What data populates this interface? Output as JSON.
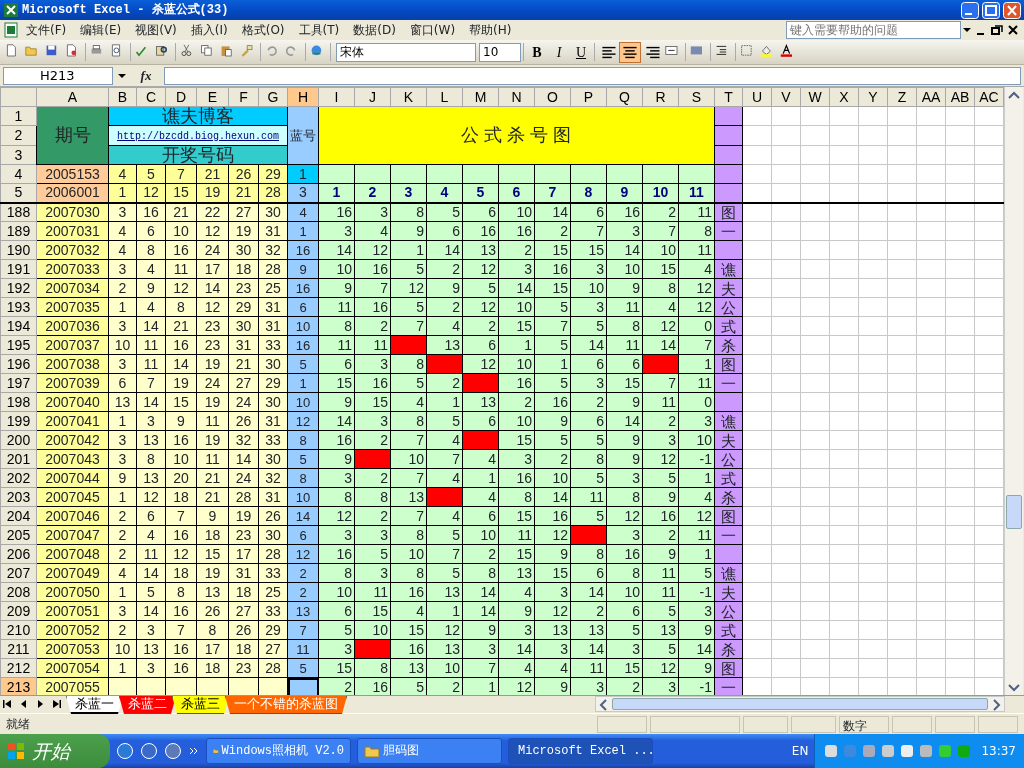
{
  "window": {
    "title": "Microsoft Excel - 杀蓝公式(33)"
  },
  "menu": [
    "文件(F)",
    "编辑(E)",
    "视图(V)",
    "插入(I)",
    "格式(O)",
    "工具(T)",
    "数据(D)",
    "窗口(W)",
    "帮助(H)"
  ],
  "help_box": {
    "placeholder": "键入需要帮助的问题"
  },
  "font": {
    "name": "宋体",
    "size": "10"
  },
  "format_buttons": [
    {
      "label": "B",
      "selected": false
    },
    {
      "label": "I",
      "selected": false
    },
    {
      "label": "U",
      "selected": false
    }
  ],
  "alignment": [
    {
      "kind": "left",
      "selected": false
    },
    {
      "kind": "center",
      "selected": true
    },
    {
      "kind": "right",
      "selected": false
    }
  ],
  "name_box": "H213",
  "fx_label": "fx",
  "columns": [
    {
      "label": "A",
      "selected": false
    },
    {
      "label": "B",
      "selected": false
    },
    {
      "label": "C",
      "selected": false
    },
    {
      "label": "D",
      "selected": false
    },
    {
      "label": "E",
      "selected": false
    },
    {
      "label": "F",
      "selected": false
    },
    {
      "label": "G",
      "selected": false
    },
    {
      "label": "H",
      "selected": true
    },
    {
      "label": "I",
      "selected": false
    },
    {
      "label": "J",
      "selected": false
    },
    {
      "label": "K",
      "selected": false
    },
    {
      "label": "L",
      "selected": false
    },
    {
      "label": "M",
      "selected": false
    },
    {
      "label": "N",
      "selected": false
    },
    {
      "label": "O",
      "selected": false
    },
    {
      "label": "P",
      "selected": false
    },
    {
      "label": "Q",
      "selected": false
    },
    {
      "label": "R",
      "selected": false
    },
    {
      "label": "S",
      "selected": false
    },
    {
      "label": "T",
      "selected": false
    },
    {
      "label": "U",
      "selected": false
    },
    {
      "label": "V",
      "selected": false
    },
    {
      "label": "W",
      "selected": false
    },
    {
      "label": "X",
      "selected": false
    },
    {
      "label": "Y",
      "selected": false
    },
    {
      "label": "Z",
      "selected": false
    },
    {
      "label": "AA",
      "selected": false
    },
    {
      "label": "AB",
      "selected": false
    },
    {
      "label": "AC",
      "selected": false
    }
  ],
  "header_block": {
    "row_numbers": [
      "1",
      "2",
      "3"
    ],
    "issue_label": "期号",
    "blog": "谯夫博客",
    "link": "http://bzcdd.biog.hexun.com",
    "draw_label": "开奖号码",
    "blue_label": "蓝号",
    "chart_title": "公 式 杀 号 图"
  },
  "seed_rows": [
    {
      "row": "4",
      "issue": "2005153",
      "nums": [
        "4",
        "5",
        "7",
        "21",
        "26",
        "29"
      ],
      "blue": "1"
    },
    {
      "row": "5",
      "issue": "2006001",
      "nums": [
        "1",
        "12",
        "15",
        "19",
        "21",
        "28"
      ],
      "blue": "3",
      "formula_numbers": [
        "1",
        "2",
        "3",
        "4",
        "5",
        "6",
        "7",
        "8",
        "9",
        "10",
        "11"
      ]
    }
  ],
  "data_rows": [
    {
      "row": "188",
      "selected": false,
      "issue": "2007030",
      "nums": [
        "3",
        "16",
        "21",
        "22",
        "27",
        "30"
      ],
      "blue": "4",
      "note": "图",
      "kill": [
        {
          "value": "16",
          "hit": false
        },
        {
          "value": "3",
          "hit": false
        },
        {
          "value": "8",
          "hit": false
        },
        {
          "value": "5",
          "hit": false
        },
        {
          "value": "6",
          "hit": false
        },
        {
          "value": "10",
          "hit": false
        },
        {
          "value": "14",
          "hit": false
        },
        {
          "value": "6",
          "hit": false
        },
        {
          "value": "16",
          "hit": false
        },
        {
          "value": "2",
          "hit": false
        },
        {
          "value": "11",
          "hit": false
        }
      ]
    },
    {
      "row": "189",
      "selected": false,
      "issue": "2007031",
      "nums": [
        "4",
        "6",
        "10",
        "12",
        "19",
        "31"
      ],
      "blue": "1",
      "note": "一",
      "kill": [
        {
          "value": "3",
          "hit": false
        },
        {
          "value": "4",
          "hit": false
        },
        {
          "value": "9",
          "hit": false
        },
        {
          "value": "6",
          "hit": false
        },
        {
          "value": "16",
          "hit": false
        },
        {
          "value": "16",
          "hit": false
        },
        {
          "value": "2",
          "hit": false
        },
        {
          "value": "7",
          "hit": false
        },
        {
          "value": "3",
          "hit": false
        },
        {
          "value": "7",
          "hit": false
        },
        {
          "value": "8",
          "hit": false
        }
      ]
    },
    {
      "row": "190",
      "selected": false,
      "issue": "2007032",
      "nums": [
        "4",
        "8",
        "16",
        "24",
        "30",
        "32"
      ],
      "blue": "16",
      "kill": [
        {
          "value": "14",
          "hit": false
        },
        {
          "value": "12",
          "hit": false
        },
        {
          "value": "1",
          "hit": false
        },
        {
          "value": "14",
          "hit": false
        },
        {
          "value": "13",
          "hit": false
        },
        {
          "value": "2",
          "hit": false
        },
        {
          "value": "15",
          "hit": false
        },
        {
          "value": "15",
          "hit": false
        },
        {
          "value": "14",
          "hit": false
        },
        {
          "value": "10",
          "hit": false
        },
        {
          "value": "11",
          "hit": false
        }
      ]
    },
    {
      "row": "191",
      "selected": false,
      "issue": "2007033",
      "nums": [
        "3",
        "4",
        "11",
        "17",
        "18",
        "28"
      ],
      "blue": "9",
      "note": "谯",
      "kill": [
        {
          "value": "10",
          "hit": false
        },
        {
          "value": "16",
          "hit": false
        },
        {
          "value": "5",
          "hit": false
        },
        {
          "value": "2",
          "hit": false
        },
        {
          "value": "12",
          "hit": false
        },
        {
          "value": "3",
          "hit": false
        },
        {
          "value": "16",
          "hit": false
        },
        {
          "value": "3",
          "hit": false
        },
        {
          "value": "10",
          "hit": false
        },
        {
          "value": "15",
          "hit": false
        },
        {
          "value": "4",
          "hit": false
        }
      ]
    },
    {
      "row": "192",
      "selected": false,
      "issue": "2007034",
      "nums": [
        "2",
        "9",
        "12",
        "14",
        "23",
        "25"
      ],
      "blue": "16",
      "note": "夫",
      "kill": [
        {
          "value": "9",
          "hit": false
        },
        {
          "value": "7",
          "hit": false
        },
        {
          "value": "12",
          "hit": false
        },
        {
          "value": "9",
          "hit": false
        },
        {
          "value": "5",
          "hit": false
        },
        {
          "value": "14",
          "hit": false
        },
        {
          "value": "15",
          "hit": false
        },
        {
          "value": "10",
          "hit": false
        },
        {
          "value": "9",
          "hit": false
        },
        {
          "value": "8",
          "hit": false
        },
        {
          "value": "12",
          "hit": false
        }
      ]
    },
    {
      "row": "193",
      "selected": false,
      "issue": "2007035",
      "nums": [
        "1",
        "4",
        "8",
        "12",
        "29",
        "31"
      ],
      "blue": "6",
      "note": "公",
      "kill": [
        {
          "value": "11",
          "hit": false
        },
        {
          "value": "16",
          "hit": false
        },
        {
          "value": "5",
          "hit": false
        },
        {
          "value": "2",
          "hit": false
        },
        {
          "value": "12",
          "hit": false
        },
        {
          "value": "10",
          "hit": false
        },
        {
          "value": "5",
          "hit": false
        },
        {
          "value": "3",
          "hit": false
        },
        {
          "value": "11",
          "hit": false
        },
        {
          "value": "4",
          "hit": false
        },
        {
          "value": "12",
          "hit": false
        }
      ]
    },
    {
      "row": "194",
      "selected": false,
      "issue": "2007036",
      "nums": [
        "3",
        "14",
        "21",
        "23",
        "30",
        "31"
      ],
      "blue": "10",
      "note": "式",
      "kill": [
        {
          "value": "8",
          "hit": false
        },
        {
          "value": "2",
          "hit": false
        },
        {
          "value": "7",
          "hit": false
        },
        {
          "value": "4",
          "hit": false
        },
        {
          "value": "2",
          "hit": false
        },
        {
          "value": "15",
          "hit": false
        },
        {
          "value": "7",
          "hit": false
        },
        {
          "value": "5",
          "hit": false
        },
        {
          "value": "8",
          "hit": false
        },
        {
          "value": "12",
          "hit": false
        },
        {
          "value": "0",
          "hit": false
        }
      ]
    },
    {
      "row": "195",
      "selected": false,
      "issue": "2007037",
      "nums": [
        "10",
        "11",
        "16",
        "23",
        "31",
        "33"
      ],
      "blue": "16",
      "note": "杀",
      "kill": [
        {
          "value": "11",
          "hit": false
        },
        {
          "value": "11",
          "hit": false
        },
        {
          "hit": true
        },
        {
          "value": "13",
          "hit": false
        },
        {
          "value": "6",
          "hit": false
        },
        {
          "value": "1",
          "hit": false
        },
        {
          "value": "5",
          "hit": false
        },
        {
          "value": "14",
          "hit": false
        },
        {
          "value": "11",
          "hit": false
        },
        {
          "value": "14",
          "hit": false
        },
        {
          "value": "7",
          "hit": false
        }
      ]
    },
    {
      "row": "196",
      "selected": false,
      "issue": "2007038",
      "nums": [
        "3",
        "11",
        "14",
        "19",
        "21",
        "30"
      ],
      "blue": "5",
      "note": "图",
      "kill": [
        {
          "value": "6",
          "hit": false
        },
        {
          "value": "3",
          "hit": false
        },
        {
          "value": "8",
          "hit": false
        },
        {
          "hit": true
        },
        {
          "value": "12",
          "hit": false
        },
        {
          "value": "10",
          "hit": false
        },
        {
          "value": "1",
          "hit": false
        },
        {
          "value": "6",
          "hit": false
        },
        {
          "value": "6",
          "hit": false
        },
        {
          "hit": true
        },
        {
          "value": "1",
          "hit": false
        }
      ]
    },
    {
      "row": "197",
      "selected": false,
      "issue": "2007039",
      "nums": [
        "6",
        "7",
        "19",
        "24",
        "27",
        "29"
      ],
      "blue": "1",
      "note": "一",
      "kill": [
        {
          "value": "15",
          "hit": false
        },
        {
          "value": "16",
          "hit": false
        },
        {
          "value": "5",
          "hit": false
        },
        {
          "value": "2",
          "hit": false
        },
        {
          "hit": true
        },
        {
          "value": "16",
          "hit": false
        },
        {
          "value": "5",
          "hit": false
        },
        {
          "value": "3",
          "hit": false
        },
        {
          "value": "15",
          "hit": false
        },
        {
          "value": "7",
          "hit": false
        },
        {
          "value": "11",
          "hit": false
        }
      ]
    },
    {
      "row": "198",
      "selected": false,
      "issue": "2007040",
      "nums": [
        "13",
        "14",
        "15",
        "19",
        "24",
        "30"
      ],
      "blue": "10",
      "kill": [
        {
          "value": "9",
          "hit": false
        },
        {
          "value": "15",
          "hit": false
        },
        {
          "value": "4",
          "hit": false
        },
        {
          "value": "1",
          "hit": false
        },
        {
          "value": "13",
          "hit": false
        },
        {
          "value": "2",
          "hit": false
        },
        {
          "value": "16",
          "hit": false
        },
        {
          "value": "2",
          "hit": false
        },
        {
          "value": "9",
          "hit": false
        },
        {
          "value": "11",
          "hit": false
        },
        {
          "value": "0",
          "hit": false
        }
      ]
    },
    {
      "row": "199",
      "selected": false,
      "issue": "2007041",
      "nums": [
        "1",
        "3",
        "9",
        "11",
        "26",
        "31"
      ],
      "blue": "12",
      "note": "谯",
      "kill": [
        {
          "value": "14",
          "hit": false
        },
        {
          "value": "3",
          "hit": false
        },
        {
          "value": "8",
          "hit": false
        },
        {
          "value": "5",
          "hit": false
        },
        {
          "value": "6",
          "hit": false
        },
        {
          "value": "10",
          "hit": false
        },
        {
          "value": "9",
          "hit": false
        },
        {
          "value": "6",
          "hit": false
        },
        {
          "value": "14",
          "hit": false
        },
        {
          "value": "2",
          "hit": false
        },
        {
          "value": "3",
          "hit": false
        }
      ]
    },
    {
      "row": "200",
      "selected": false,
      "issue": "2007042",
      "nums": [
        "3",
        "13",
        "16",
        "19",
        "32",
        "33"
      ],
      "blue": "8",
      "note": "夫",
      "kill": [
        {
          "value": "16",
          "hit": false
        },
        {
          "value": "2",
          "hit": false
        },
        {
          "value": "7",
          "hit": false
        },
        {
          "value": "4",
          "hit": false
        },
        {
          "hit": true
        },
        {
          "value": "15",
          "hit": false
        },
        {
          "value": "5",
          "hit": false
        },
        {
          "value": "5",
          "hit": false
        },
        {
          "value": "9",
          "hit": false
        },
        {
          "value": "3",
          "hit": false
        },
        {
          "value": "10",
          "hit": false
        }
      ]
    },
    {
      "row": "201",
      "selected": false,
      "issue": "2007043",
      "nums": [
        "3",
        "8",
        "10",
        "11",
        "14",
        "30"
      ],
      "blue": "5",
      "note": "公",
      "kill": [
        {
          "value": "9",
          "hit": false
        },
        {
          "hit": true
        },
        {
          "value": "10",
          "hit": false
        },
        {
          "value": "7",
          "hit": false
        },
        {
          "value": "4",
          "hit": false
        },
        {
          "value": "3",
          "hit": false
        },
        {
          "value": "2",
          "hit": false
        },
        {
          "value": "8",
          "hit": false
        },
        {
          "value": "9",
          "hit": false
        },
        {
          "value": "12",
          "hit": false
        },
        {
          "value": "-1",
          "hit": false
        }
      ]
    },
    {
      "row": "202",
      "selected": false,
      "issue": "2007044",
      "nums": [
        "9",
        "13",
        "20",
        "21",
        "24",
        "32"
      ],
      "blue": "8",
      "note": "式",
      "kill": [
        {
          "value": "3",
          "hit": false
        },
        {
          "value": "2",
          "hit": false
        },
        {
          "value": "7",
          "hit": false
        },
        {
          "value": "4",
          "hit": false
        },
        {
          "value": "1",
          "hit": false
        },
        {
          "value": "16",
          "hit": false
        },
        {
          "value": "10",
          "hit": false
        },
        {
          "value": "5",
          "hit": false
        },
        {
          "value": "3",
          "hit": false
        },
        {
          "value": "5",
          "hit": false
        },
        {
          "value": "1",
          "hit": false
        }
      ]
    },
    {
      "row": "203",
      "selected": false,
      "issue": "2007045",
      "nums": [
        "1",
        "12",
        "18",
        "21",
        "28",
        "31"
      ],
      "blue": "10",
      "note": "杀",
      "kill": [
        {
          "value": "8",
          "hit": false
        },
        {
          "value": "8",
          "hit": false
        },
        {
          "value": "13",
          "hit": false
        },
        {
          "hit": true
        },
        {
          "value": "4",
          "hit": false
        },
        {
          "value": "8",
          "hit": false
        },
        {
          "value": "14",
          "hit": false
        },
        {
          "value": "11",
          "hit": false
        },
        {
          "value": "8",
          "hit": false
        },
        {
          "value": "9",
          "hit": false
        },
        {
          "value": "4",
          "hit": false
        }
      ]
    },
    {
      "row": "204",
      "selected": false,
      "issue": "2007046",
      "nums": [
        "2",
        "6",
        "7",
        "9",
        "19",
        "26"
      ],
      "blue": "14",
      "note": "图",
      "kill": [
        {
          "value": "12",
          "hit": false
        },
        {
          "value": "2",
          "hit": false
        },
        {
          "value": "7",
          "hit": false
        },
        {
          "value": "4",
          "hit": false
        },
        {
          "value": "6",
          "hit": false
        },
        {
          "value": "15",
          "hit": false
        },
        {
          "value": "16",
          "hit": false
        },
        {
          "value": "5",
          "hit": false
        },
        {
          "value": "12",
          "hit": false
        },
        {
          "value": "16",
          "hit": false
        },
        {
          "value": "12",
          "hit": false
        }
      ]
    },
    {
      "row": "205",
      "selected": false,
      "issue": "2007047",
      "nums": [
        "2",
        "4",
        "16",
        "18",
        "23",
        "30"
      ],
      "blue": "6",
      "note": "一",
      "kill": [
        {
          "value": "3",
          "hit": false
        },
        {
          "value": "3",
          "hit": false
        },
        {
          "value": "8",
          "hit": false
        },
        {
          "value": "5",
          "hit": false
        },
        {
          "value": "10",
          "hit": false
        },
        {
          "value": "11",
          "hit": false
        },
        {
          "value": "12",
          "hit": false
        },
        {
          "hit": true
        },
        {
          "value": "3",
          "hit": false
        },
        {
          "value": "2",
          "hit": false
        },
        {
          "value": "11",
          "hit": false
        }
      ]
    },
    {
      "row": "206",
      "selected": false,
      "issue": "2007048",
      "nums": [
        "2",
        "11",
        "12",
        "15",
        "17",
        "28"
      ],
      "blue": "12",
      "kill": [
        {
          "value": "16",
          "hit": false
        },
        {
          "value": "5",
          "hit": false
        },
        {
          "value": "10",
          "hit": false
        },
        {
          "value": "7",
          "hit": false
        },
        {
          "value": "2",
          "hit": false
        },
        {
          "value": "15",
          "hit": false
        },
        {
          "value": "9",
          "hit": false
        },
        {
          "value": "8",
          "hit": false
        },
        {
          "value": "16",
          "hit": false
        },
        {
          "value": "9",
          "hit": false
        },
        {
          "value": "1",
          "hit": false
        }
      ]
    },
    {
      "row": "207",
      "selected": false,
      "issue": "2007049",
      "nums": [
        "4",
        "14",
        "18",
        "19",
        "31",
        "33"
      ],
      "blue": "2",
      "note": "谯",
      "kill": [
        {
          "value": "8",
          "hit": false
        },
        {
          "value": "3",
          "hit": false
        },
        {
          "value": "8",
          "hit": false
        },
        {
          "value": "5",
          "hit": false
        },
        {
          "value": "8",
          "hit": false
        },
        {
          "value": "13",
          "hit": false
        },
        {
          "value": "15",
          "hit": false
        },
        {
          "value": "6",
          "hit": false
        },
        {
          "value": "8",
          "hit": false
        },
        {
          "value": "11",
          "hit": false
        },
        {
          "value": "5",
          "hit": false
        }
      ]
    },
    {
      "row": "208",
      "selected": false,
      "issue": "2007050",
      "nums": [
        "1",
        "5",
        "8",
        "13",
        "18",
        "25"
      ],
      "blue": "2",
      "note": "夫",
      "kill": [
        {
          "value": "10",
          "hit": false
        },
        {
          "value": "11",
          "hit": false
        },
        {
          "value": "16",
          "hit": false
        },
        {
          "value": "13",
          "hit": false
        },
        {
          "value": "14",
          "hit": false
        },
        {
          "value": "4",
          "hit": false
        },
        {
          "value": "3",
          "hit": false
        },
        {
          "value": "14",
          "hit": false
        },
        {
          "value": "10",
          "hit": false
        },
        {
          "value": "11",
          "hit": false
        },
        {
          "value": "-1",
          "hit": false
        }
      ]
    },
    {
      "row": "209",
      "selected": false,
      "issue": "2007051",
      "nums": [
        "3",
        "14",
        "16",
        "26",
        "27",
        "33"
      ],
      "blue": "13",
      "note": "公",
      "kill": [
        {
          "value": "6",
          "hit": false
        },
        {
          "value": "15",
          "hit": false
        },
        {
          "value": "4",
          "hit": false
        },
        {
          "value": "1",
          "hit": false
        },
        {
          "value": "14",
          "hit": false
        },
        {
          "value": "9",
          "hit": false
        },
        {
          "value": "12",
          "hit": false
        },
        {
          "value": "2",
          "hit": false
        },
        {
          "value": "6",
          "hit": false
        },
        {
          "value": "5",
          "hit": false
        },
        {
          "value": "3",
          "hit": false
        }
      ]
    },
    {
      "row": "210",
      "selected": false,
      "issue": "2007052",
      "nums": [
        "2",
        "3",
        "7",
        "8",
        "26",
        "29"
      ],
      "blue": "7",
      "note": "式",
      "kill": [
        {
          "value": "5",
          "hit": false
        },
        {
          "value": "10",
          "hit": false
        },
        {
          "value": "15",
          "hit": false
        },
        {
          "value": "12",
          "hit": false
        },
        {
          "value": "9",
          "hit": false
        },
        {
          "value": "3",
          "hit": false
        },
        {
          "value": "13",
          "hit": false
        },
        {
          "value": "13",
          "hit": false
        },
        {
          "value": "5",
          "hit": false
        },
        {
          "value": "13",
          "hit": false
        },
        {
          "value": "9",
          "hit": false
        }
      ]
    },
    {
      "row": "211",
      "selected": false,
      "issue": "2007053",
      "nums": [
        "10",
        "13",
        "16",
        "17",
        "18",
        "27"
      ],
      "blue": "11",
      "note": "杀",
      "kill": [
        {
          "value": "3",
          "hit": false
        },
        {
          "hit": true
        },
        {
          "value": "16",
          "hit": false
        },
        {
          "value": "13",
          "hit": false
        },
        {
          "value": "3",
          "hit": false
        },
        {
          "value": "14",
          "hit": false
        },
        {
          "value": "3",
          "hit": false
        },
        {
          "value": "14",
          "hit": false
        },
        {
          "value": "3",
          "hit": false
        },
        {
          "value": "5",
          "hit": false
        },
        {
          "value": "14",
          "hit": false
        }
      ]
    },
    {
      "row": "212",
      "selected": false,
      "issue": "2007054",
      "nums": [
        "1",
        "3",
        "16",
        "18",
        "23",
        "28"
      ],
      "blue": "5",
      "note": "图",
      "kill": [
        {
          "value": "15",
          "hit": false
        },
        {
          "value": "8",
          "hit": false
        },
        {
          "value": "13",
          "hit": false
        },
        {
          "value": "10",
          "hit": false
        },
        {
          "value": "7",
          "hit": false
        },
        {
          "value": "4",
          "hit": false
        },
        {
          "value": "4",
          "hit": false
        },
        {
          "value": "11",
          "hit": false
        },
        {
          "value": "15",
          "hit": false
        },
        {
          "value": "12",
          "hit": false
        },
        {
          "value": "9",
          "hit": false
        }
      ]
    },
    {
      "row": "213",
      "selected": true,
      "issue": "2007055",
      "note": "一",
      "kill": [
        {
          "value": "2",
          "hit": false
        },
        {
          "value": "16",
          "hit": false
        },
        {
          "value": "5",
          "hit": false
        },
        {
          "value": "2",
          "hit": false
        },
        {
          "value": "1",
          "hit": false
        },
        {
          "value": "12",
          "hit": false
        },
        {
          "value": "9",
          "hit": false
        },
        {
          "value": "3",
          "hit": false
        },
        {
          "value": "2",
          "hit": false
        },
        {
          "value": "3",
          "hit": false
        },
        {
          "value": "-1",
          "hit": false
        }
      ]
    }
  ],
  "sheet_tabs": [
    {
      "label": "杀蓝一",
      "selected": true,
      "color": "#ffffff"
    },
    {
      "label": "杀蓝二",
      "selected": false,
      "color": "#ff0000"
    },
    {
      "label": "杀蓝三",
      "selected": false,
      "color": "#ffff00"
    },
    {
      "label": "一个不错的杀蓝图",
      "selected": false,
      "color": "#ff6600"
    }
  ],
  "status_bar": {
    "left": "就绪",
    "mode": "数字"
  },
  "taskbar": {
    "start": "开始",
    "tasks": [
      {
        "label": "Windows照相机 V2.0",
        "selected": false,
        "kind": "folder"
      },
      {
        "label": "胆码图",
        "selected": false,
        "kind": "folder"
      },
      {
        "label": "Microsoft Excel ...",
        "selected": true,
        "kind": "excel"
      }
    ],
    "language": "EN",
    "clock": "13:37"
  }
}
